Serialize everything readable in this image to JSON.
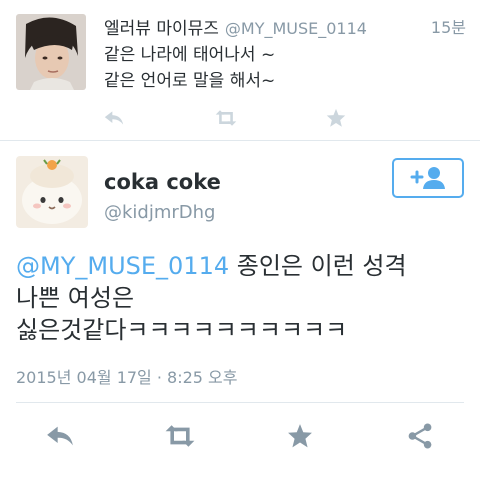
{
  "parent_tweet": {
    "display_name": "엘러뷰 마이뮤즈",
    "handle": "@MY_MUSE_0114",
    "time": "15분",
    "lines": [
      "같은 나라에 태어나서 ~",
      "같은 언어로 말을 해서~"
    ],
    "actions": [
      "reply-icon",
      "retweet-icon",
      "favorite-icon"
    ]
  },
  "main_tweet": {
    "display_name": "coka coke",
    "handle": "@kidjmrDhg",
    "follow_icon": "add-user-icon",
    "mention": "@MY_MUSE_0114",
    "line1_rest": " 종인은 이런 성격",
    "line2": "나쁜 여성은",
    "line3": "싫은것같다ㅋㅋㅋㅋㅋㅋㅋㅋㅋㅋ",
    "timestamp": "2015년 04월 17일 · 8:25 오후",
    "actions": [
      "reply-icon",
      "retweet-icon",
      "favorite-icon",
      "share-icon"
    ]
  },
  "colors": {
    "accent": "#55acee",
    "muted": "#8899a6",
    "text": "#292f33",
    "action_dim": "#ccd6dd",
    "action": "#8899a6"
  }
}
